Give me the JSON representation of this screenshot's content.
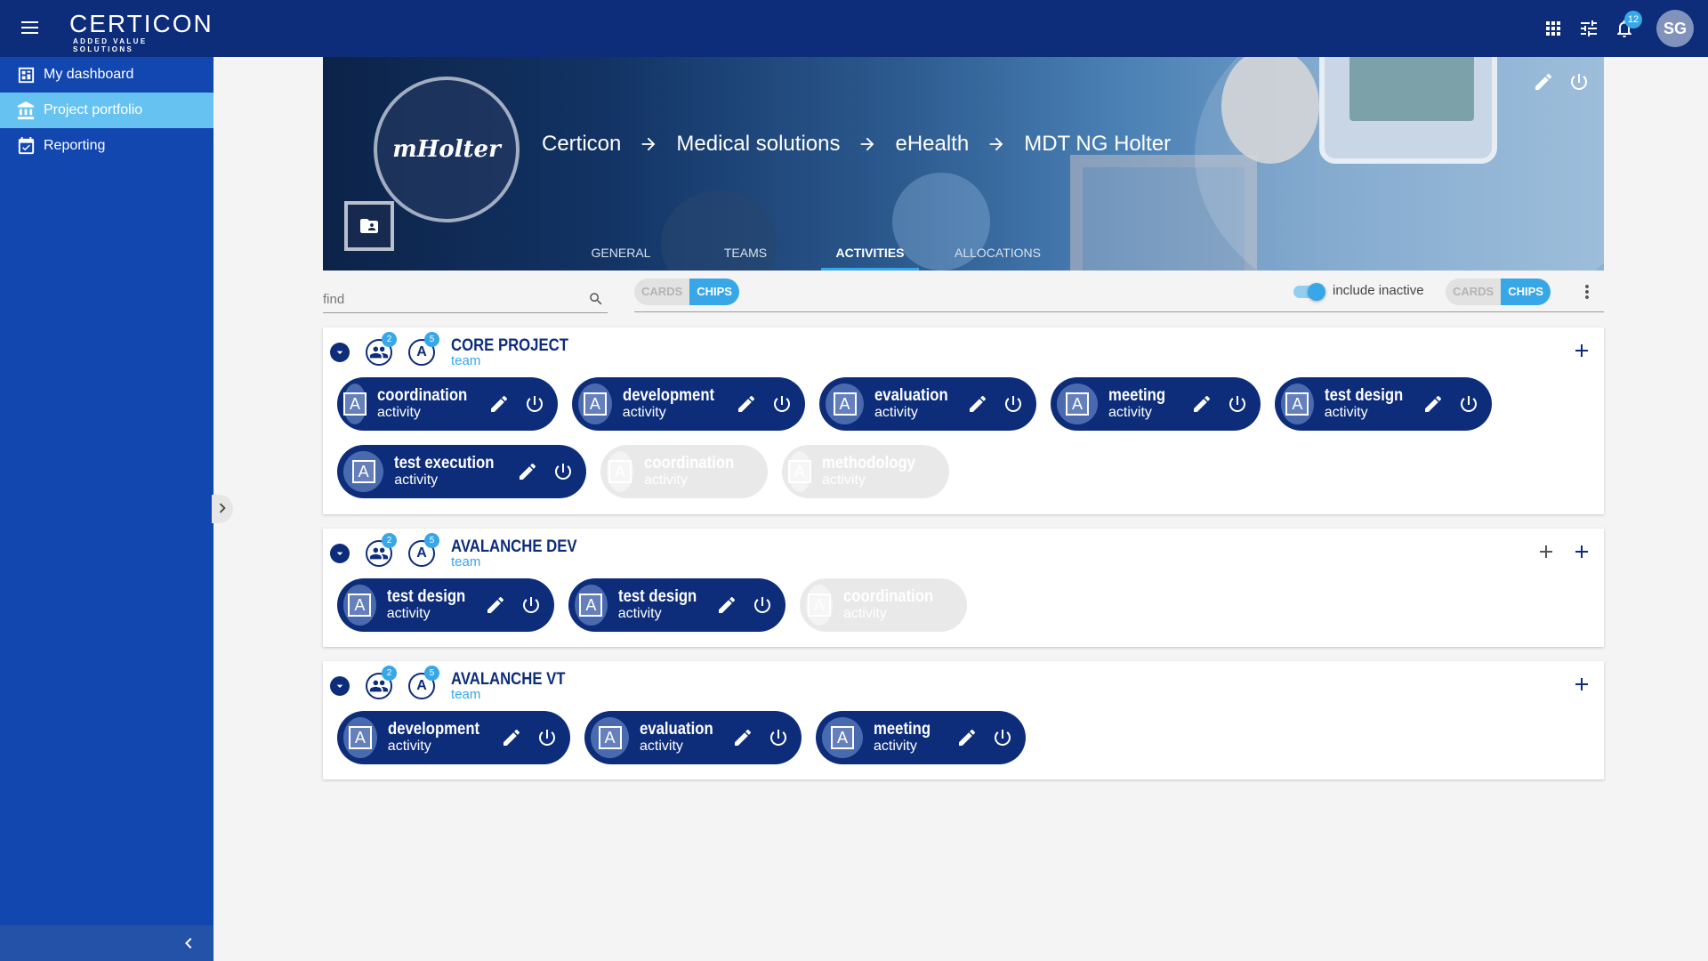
{
  "app": {
    "brand_name": "CERTICON",
    "brand_tagline": "ADDED VALUE SOLUTIONS",
    "notifications_count": "12",
    "user_initials": "SG"
  },
  "sidebar": {
    "items": [
      {
        "label": "My dashboard",
        "icon": "dashboard-icon",
        "active": false
      },
      {
        "label": "Project portfolio",
        "icon": "bank-icon",
        "active": true
      },
      {
        "label": "Reporting",
        "icon": "calendar-check-icon",
        "active": false
      }
    ]
  },
  "project": {
    "logo_text": "mHolter",
    "breadcrumb": [
      "Certicon",
      "Medical solutions",
      "eHealth",
      "MDT NG Holter"
    ],
    "tabs": [
      {
        "label": "GENERAL",
        "active": false
      },
      {
        "label": "TEAMS",
        "active": false
      },
      {
        "label": "ACTIVITIES",
        "active": true
      },
      {
        "label": "ALLOCATIONS",
        "active": false
      }
    ]
  },
  "toolbar": {
    "find_placeholder": "find",
    "view_left": {
      "cards": "CARDS",
      "chips": "CHIPS",
      "selected": "CHIPS"
    },
    "include_inactive_label": "include inactive",
    "include_inactive": true,
    "view_right": {
      "cards": "CARDS",
      "chips": "CHIPS",
      "selected": "CHIPS"
    }
  },
  "teams": [
    {
      "name": "CORE PROJECT",
      "subtitle": "team",
      "members_count": "2",
      "activities_count": "5",
      "activities": [
        {
          "name": "coordination",
          "type": "activity",
          "active": true
        },
        {
          "name": "development",
          "type": "activity",
          "active": true
        },
        {
          "name": "evaluation",
          "type": "activity",
          "active": true
        },
        {
          "name": "meeting",
          "type": "activity",
          "active": true
        },
        {
          "name": "test design",
          "type": "activity",
          "active": true
        },
        {
          "name": "test execution",
          "type": "activity",
          "active": true
        },
        {
          "name": "coordination",
          "type": "activity",
          "active": false
        },
        {
          "name": "methodology",
          "type": "activity",
          "active": false
        }
      ]
    },
    {
      "name": "AVALANCHE DEV",
      "subtitle": "team",
      "members_count": "2",
      "activities_count": "5",
      "activities": [
        {
          "name": "test design",
          "type": "activity",
          "active": true
        },
        {
          "name": "test design",
          "type": "activity",
          "active": true
        },
        {
          "name": "coordination",
          "type": "activity",
          "active": false
        }
      ]
    },
    {
      "name": "AVALANCHE VT",
      "subtitle": "team",
      "members_count": "2",
      "activities_count": "5",
      "activities": [
        {
          "name": "development",
          "type": "activity",
          "active": true
        },
        {
          "name": "evaluation",
          "type": "activity",
          "active": true
        },
        {
          "name": "meeting",
          "type": "activity",
          "active": true
        }
      ]
    }
  ],
  "avatar_letter": "A",
  "colors": {
    "primary": "#0d2d7a",
    "sidebar": "#1247b0",
    "accent": "#37a7e8",
    "active_nav": "#66c2f0",
    "inactive_chip": "#e9e9e9"
  }
}
